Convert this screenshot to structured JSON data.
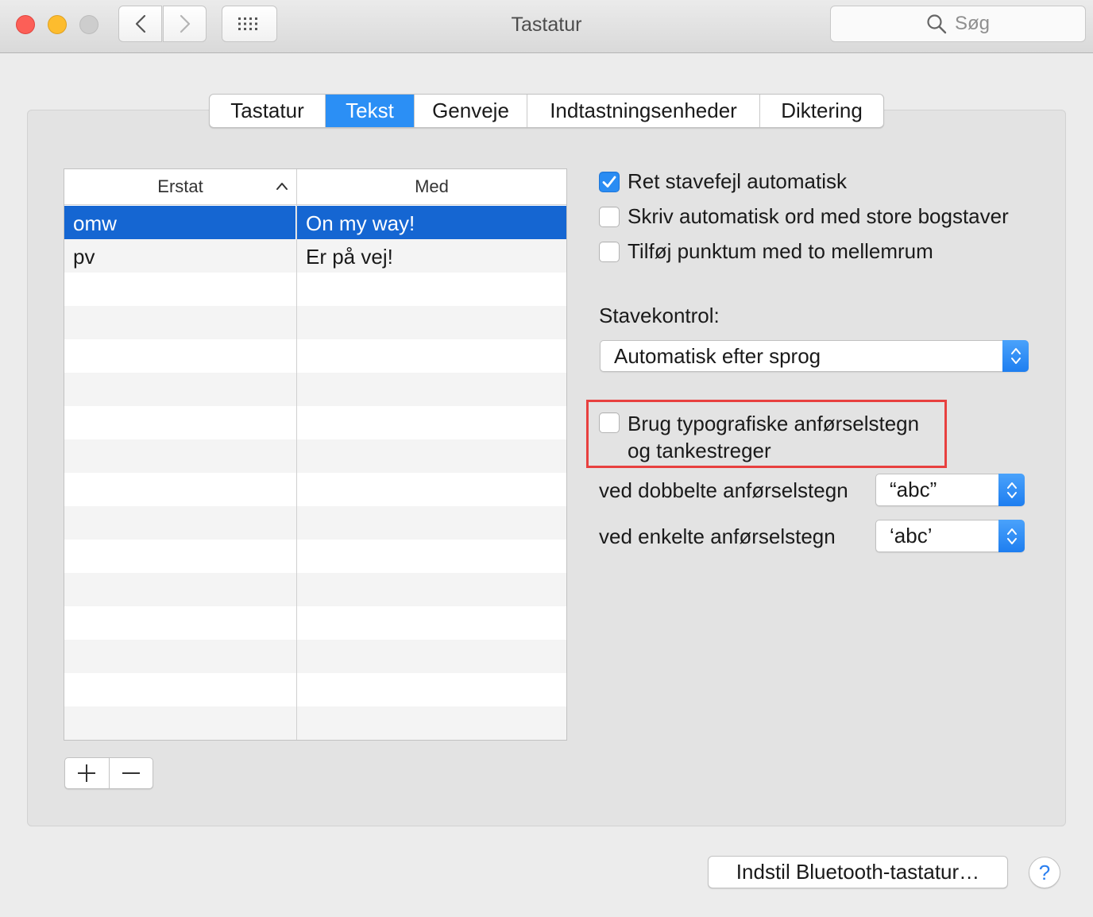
{
  "window": {
    "title": "Tastatur",
    "search_placeholder": "Søg"
  },
  "tabs": [
    {
      "label": "Tastatur",
      "active": false
    },
    {
      "label": "Tekst",
      "active": true
    },
    {
      "label": "Genveje",
      "active": false
    },
    {
      "label": "Indtastningsenheder",
      "active": false
    },
    {
      "label": "Diktering",
      "active": false
    }
  ],
  "table": {
    "columns": [
      "Erstat",
      "Med"
    ],
    "sorted_column": "Erstat",
    "sort_direction": "ascending",
    "rows": [
      {
        "replace": "omw",
        "with": "On my way!",
        "selected": true
      },
      {
        "replace": "pv",
        "with": "Er på vej!",
        "selected": false
      }
    ]
  },
  "options": {
    "autocorrect": {
      "label": "Ret stavefejl automatisk",
      "checked": true
    },
    "autocapitalize": {
      "label": "Skriv automatisk ord med store bogstaver",
      "checked": false
    },
    "period": {
      "label": "Tilføj punktum med to mellemrum",
      "checked": false
    }
  },
  "spelling": {
    "label": "Stavekontrol:",
    "value": "Automatisk efter sprog"
  },
  "smart_quotes": {
    "line1": "Brug typografiske anførselstegn",
    "line2": "og tankestreger",
    "checked": false,
    "double_label": "ved dobbelte anførselstegn",
    "double_value": "“abc”",
    "single_label": "ved enkelte anførselstegn",
    "single_value": "‘abc’"
  },
  "footer": {
    "bluetooth_button": "Indstil Bluetooth-tastatur…",
    "help_glyph": "?"
  },
  "colors": {
    "accent": "#2b8ff5",
    "selection": "#1566d2",
    "highlight_border": "#e8403f"
  }
}
